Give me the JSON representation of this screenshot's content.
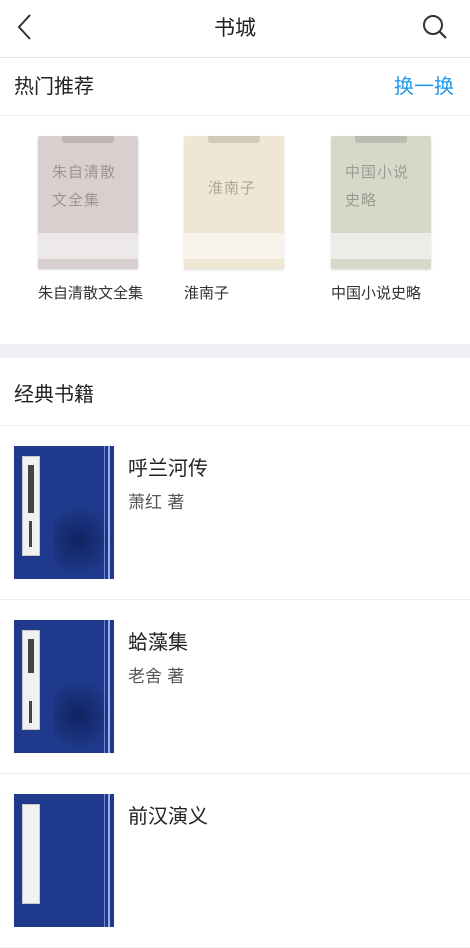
{
  "header": {
    "title": "书城",
    "back_icon": "chevron-left-icon",
    "search_icon": "search-icon"
  },
  "hot": {
    "title": "热门推荐",
    "refresh_label": "换一换",
    "items": [
      {
        "cover_text": "朱自清散文全集",
        "name": "朱自清散文全集",
        "cover_color": "#d9cfcf"
      },
      {
        "cover_text": "淮南子",
        "name": "淮南子",
        "cover_color": "#efe6d4"
      },
      {
        "cover_text": "中国小说史略",
        "name": "中国小说史略",
        "cover_color": "#d6d8c9"
      }
    ]
  },
  "classic": {
    "title": "经典书籍",
    "books": [
      {
        "title": "呼兰河传",
        "author": "萧红 著"
      },
      {
        "title": "蛤藻集",
        "author": "老舍 著"
      },
      {
        "title": "前汉演义",
        "author": ""
      }
    ]
  },
  "colors": {
    "accent": "#1e9bea",
    "cover_blue": "#1f3a8c"
  }
}
